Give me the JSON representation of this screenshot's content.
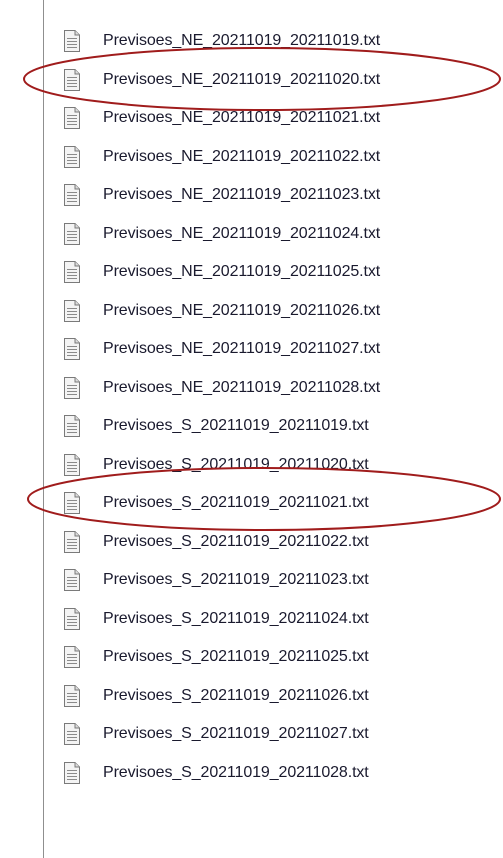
{
  "files": [
    {
      "name": "Previsoes_NE_20211019_20211019.txt",
      "icon": "text-file-icon"
    },
    {
      "name": "Previsoes_NE_20211019_20211020.txt",
      "icon": "text-file-icon"
    },
    {
      "name": "Previsoes_NE_20211019_20211021.txt",
      "icon": "text-file-icon"
    },
    {
      "name": "Previsoes_NE_20211019_20211022.txt",
      "icon": "text-file-icon"
    },
    {
      "name": "Previsoes_NE_20211019_20211023.txt",
      "icon": "text-file-icon"
    },
    {
      "name": "Previsoes_NE_20211019_20211024.txt",
      "icon": "text-file-icon"
    },
    {
      "name": "Previsoes_NE_20211019_20211025.txt",
      "icon": "text-file-icon"
    },
    {
      "name": "Previsoes_NE_20211019_20211026.txt",
      "icon": "text-file-icon"
    },
    {
      "name": "Previsoes_NE_20211019_20211027.txt",
      "icon": "text-file-icon"
    },
    {
      "name": "Previsoes_NE_20211019_20211028.txt",
      "icon": "text-file-icon"
    },
    {
      "name": "Previsoes_S_20211019_20211019.txt",
      "icon": "text-file-icon"
    },
    {
      "name": "Previsoes_S_20211019_20211020.txt",
      "icon": "text-file-icon"
    },
    {
      "name": "Previsoes_S_20211019_20211021.txt",
      "icon": "text-file-icon"
    },
    {
      "name": "Previsoes_S_20211019_20211022.txt",
      "icon": "text-file-icon"
    },
    {
      "name": "Previsoes_S_20211019_20211023.txt",
      "icon": "text-file-icon"
    },
    {
      "name": "Previsoes_S_20211019_20211024.txt",
      "icon": "text-file-icon"
    },
    {
      "name": "Previsoes_S_20211019_20211025.txt",
      "icon": "text-file-icon"
    },
    {
      "name": "Previsoes_S_20211019_20211026.txt",
      "icon": "text-file-icon"
    },
    {
      "name": "Previsoes_S_20211019_20211027.txt",
      "icon": "text-file-icon"
    },
    {
      "name": "Previsoes_S_20211019_20211028.txt",
      "icon": "text-file-icon"
    }
  ],
  "annotation_color": "#a01c1c"
}
